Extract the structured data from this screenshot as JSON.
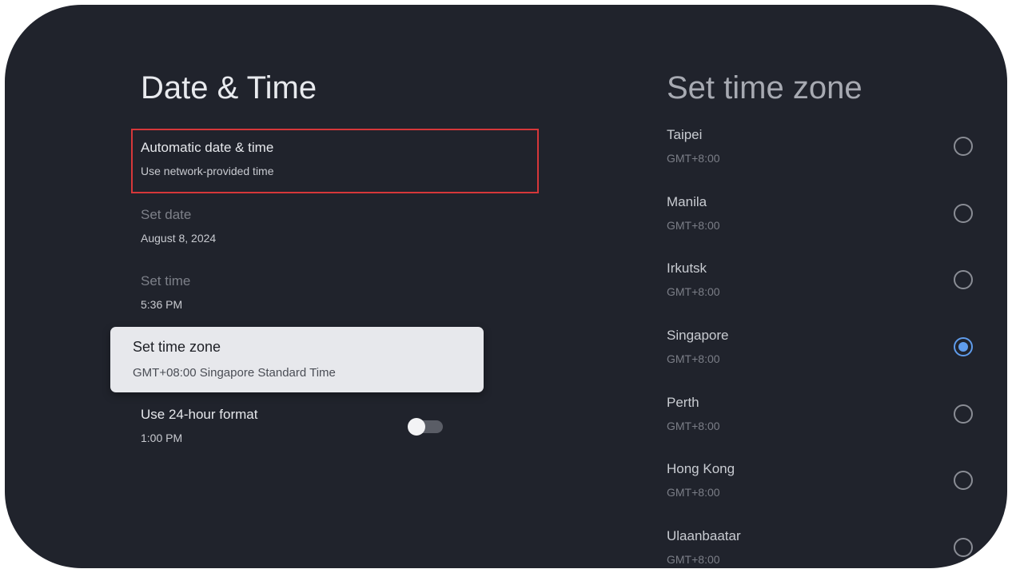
{
  "left_panel": {
    "title": "Date & Time",
    "automatic": {
      "label": "Automatic date & time",
      "value": "Use network-provided time"
    },
    "set_date": {
      "label": "Set date",
      "value": "August 8, 2024"
    },
    "set_time": {
      "label": "Set time",
      "value": "5:36 PM"
    },
    "set_time_zone": {
      "label": "Set time zone",
      "value": "GMT+08:00 Singapore Standard Time"
    },
    "use_24_hour": {
      "label": "Use 24-hour format",
      "value": "1:00 PM",
      "enabled": false
    }
  },
  "right_panel": {
    "title": "Set time zone",
    "zones": [
      {
        "name": "Taipei",
        "offset": "GMT+8:00",
        "selected": false
      },
      {
        "name": "Manila",
        "offset": "GMT+8:00",
        "selected": false
      },
      {
        "name": "Irkutsk",
        "offset": "GMT+8:00",
        "selected": false
      },
      {
        "name": "Singapore",
        "offset": "GMT+8:00",
        "selected": true
      },
      {
        "name": "Perth",
        "offset": "GMT+8:00",
        "selected": false
      },
      {
        "name": "Hong Kong",
        "offset": "GMT+8:00",
        "selected": false
      },
      {
        "name": "Ulaanbaatar",
        "offset": "GMT+8:00",
        "selected": false
      }
    ]
  },
  "colors": {
    "background": "#20232c",
    "highlight_border": "#d6373a",
    "focused_card": "#e7e8ec",
    "radio_selected": "#5f9cec"
  }
}
